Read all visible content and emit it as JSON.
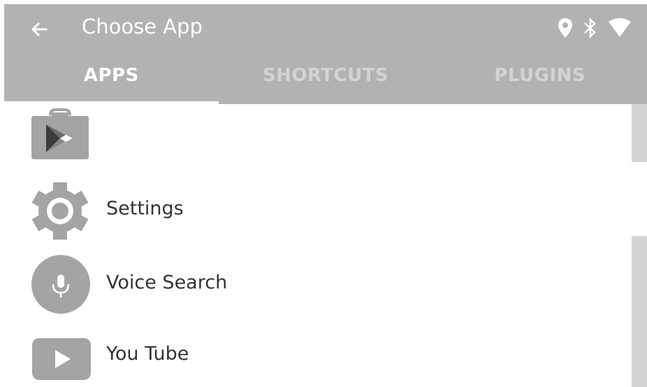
{
  "appbar": {
    "title": "Choose App",
    "back_icon": "arrow-left-icon",
    "status_icons": [
      "location-pin-icon",
      "bluetooth-icon",
      "wifi-icon"
    ],
    "background": "#b2b2b2"
  },
  "tabs": [
    {
      "label": "APPS",
      "active": true
    },
    {
      "label": "SHORTCUTS",
      "active": false
    },
    {
      "label": "PLUGINS",
      "active": false
    }
  ],
  "apps": [
    {
      "label": "",
      "icon": "play-store-icon"
    },
    {
      "label": "Settings",
      "icon": "gear-icon"
    },
    {
      "label": "Voice Search",
      "icon": "microphone-icon"
    },
    {
      "label": "You Tube",
      "icon": "youtube-play-icon"
    }
  ]
}
